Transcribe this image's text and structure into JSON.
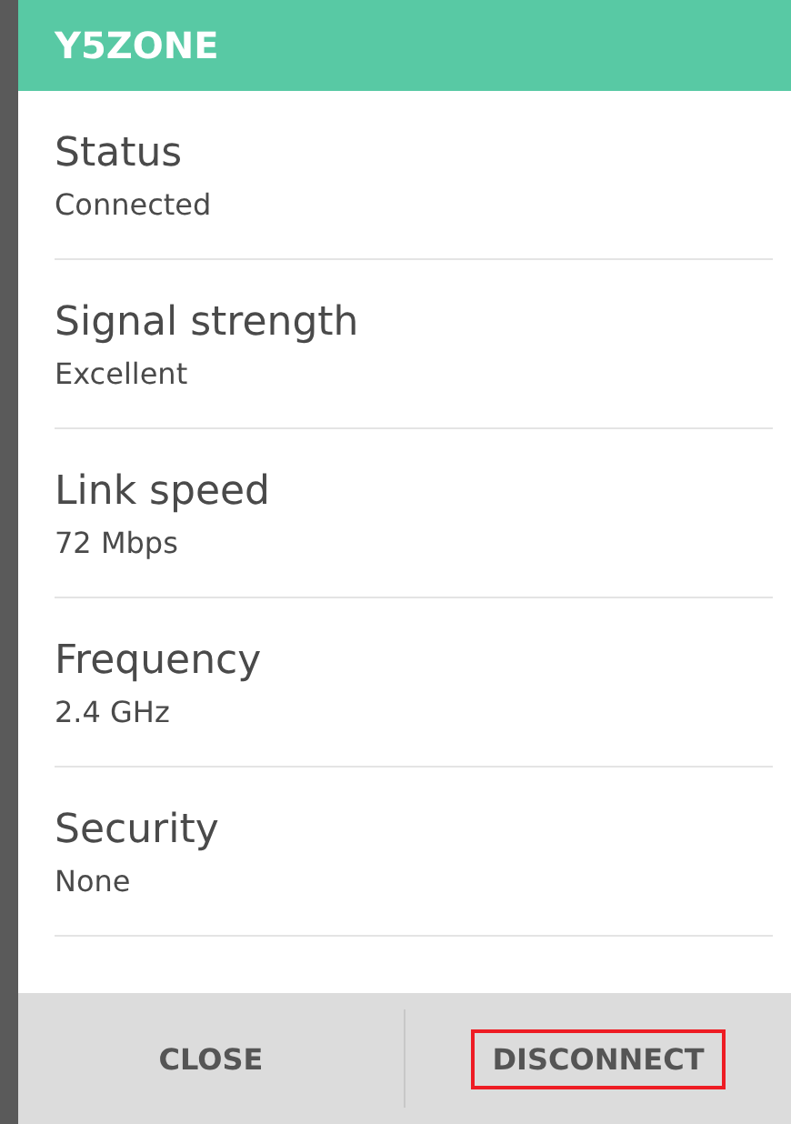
{
  "dialog": {
    "title": "Y5ZONE"
  },
  "details": [
    {
      "label": "Status",
      "value": "Connected"
    },
    {
      "label": "Signal strength",
      "value": "Excellent"
    },
    {
      "label": "Link speed",
      "value": "72 Mbps"
    },
    {
      "label": "Frequency",
      "value": "2.4 GHz"
    },
    {
      "label": "Security",
      "value": "None"
    }
  ],
  "buttons": [
    {
      "label": "CLOSE",
      "highlighted": false
    },
    {
      "label": "DISCONNECT",
      "highlighted": true
    }
  ]
}
